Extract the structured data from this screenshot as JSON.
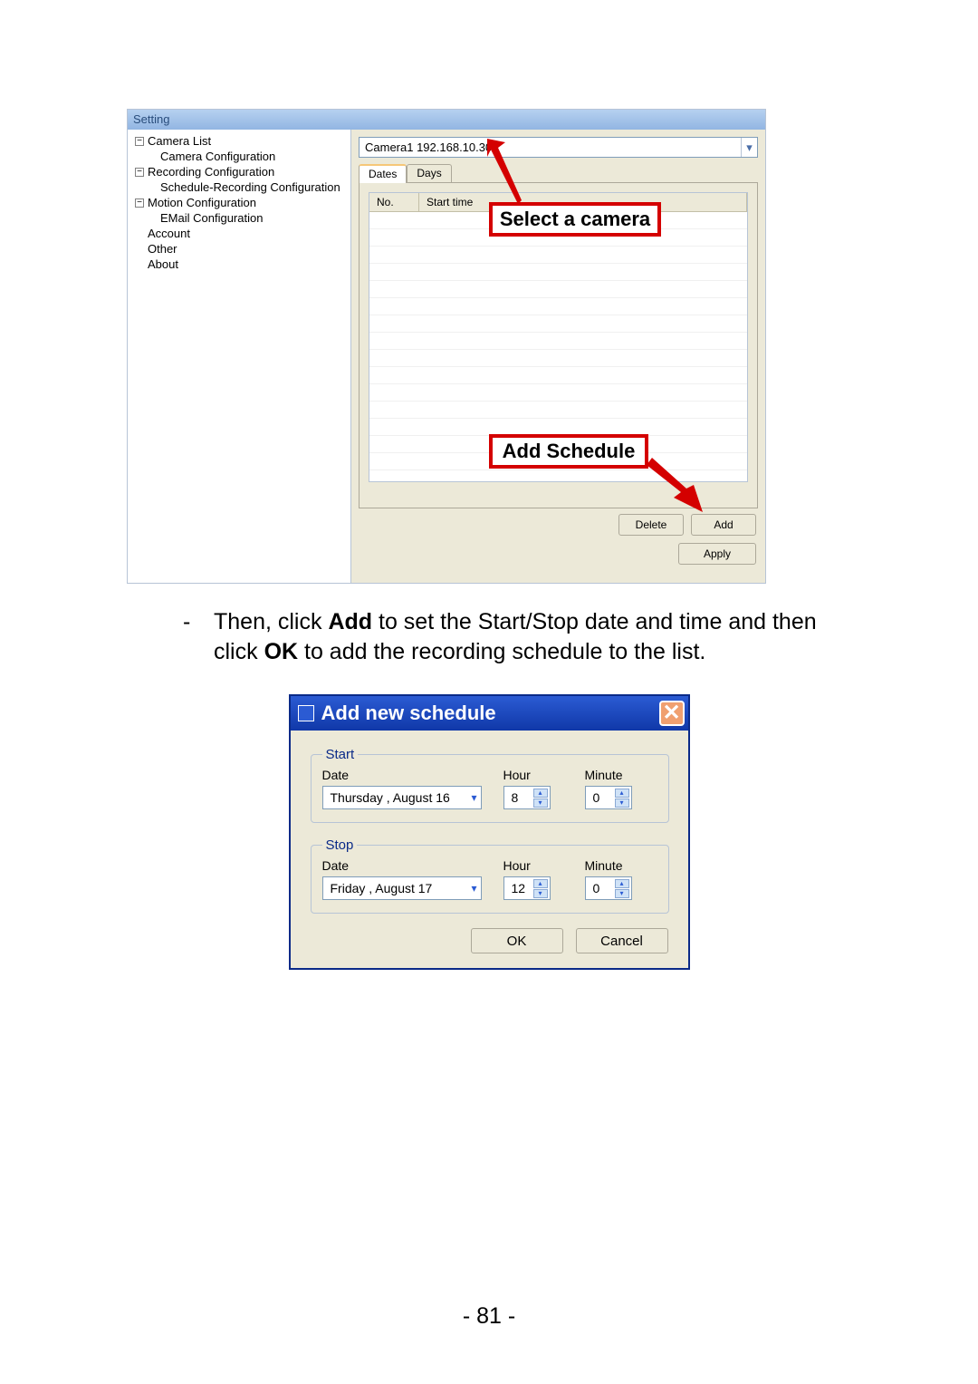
{
  "setting": {
    "title": "Setting",
    "tree": {
      "camera_list": "Camera List",
      "camera_config": "Camera Configuration",
      "recording_config": "Recording Configuration",
      "schedule_rec_config": "Schedule-Recording Configuration",
      "motion_config": "Motion Configuration",
      "email_config": "EMail Configuration",
      "account": "Account",
      "other": "Other",
      "about": "About"
    },
    "camera_selected": "Camera1 192.168.10.30",
    "tabs": {
      "dates": "Dates",
      "days": "Days"
    },
    "list_cols": {
      "no": "No.",
      "start": "Start time"
    },
    "callout_select": "Select a camera",
    "callout_add": "Add Schedule",
    "buttons": {
      "delete": "Delete",
      "add": "Add",
      "apply": "Apply"
    }
  },
  "instruction": {
    "dash": "-",
    "pre1": "Then, click ",
    "add_bold": "Add",
    "mid1": " to set the Start/Stop date and time and then click ",
    "ok_bold": "OK",
    "tail": " to add the recording schedule to the list."
  },
  "dialog": {
    "title": "Add new schedule",
    "start": {
      "legend": "Start",
      "labels": {
        "date": "Date",
        "hour": "Hour",
        "minute": "Minute"
      },
      "date_value": "Thursday ,   August   16",
      "hour": "8",
      "minute": "0"
    },
    "stop": {
      "legend": "Stop",
      "labels": {
        "date": "Date",
        "hour": "Hour",
        "minute": "Minute"
      },
      "date_value": "Friday     ,   August   17",
      "hour": "12",
      "minute": "0"
    },
    "buttons": {
      "ok": "OK",
      "cancel": "Cancel"
    }
  },
  "page_number": "- 81 -"
}
